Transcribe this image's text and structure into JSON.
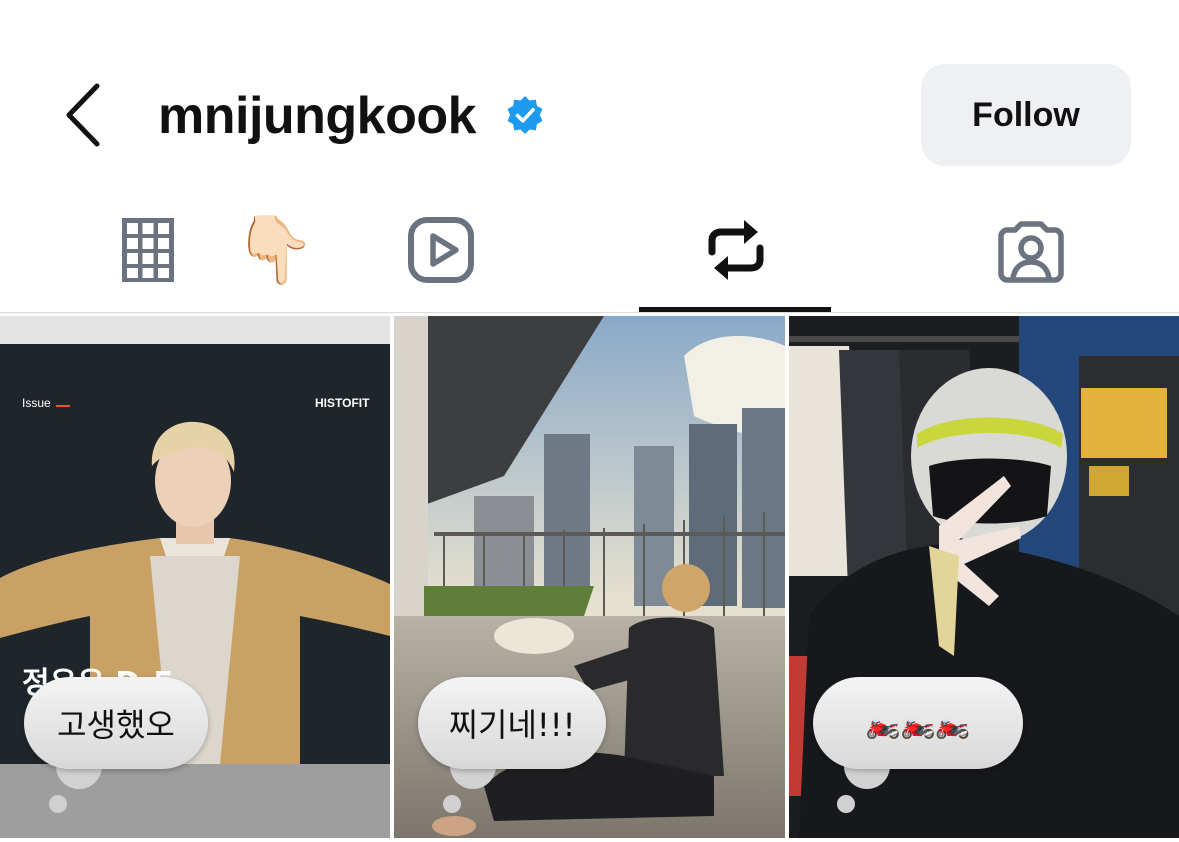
{
  "header": {
    "username": "mnijungkook",
    "follow_label": "Follow",
    "verified_color": "#1d9bf0"
  },
  "tabs": [
    {
      "name": "grid",
      "icon": "grid-icon"
    },
    {
      "name": "pointing-emoji",
      "icon": "pointing-down-emoji-icon",
      "glyph": "👇🏻"
    },
    {
      "name": "reels",
      "icon": "reels-play-icon"
    },
    {
      "name": "reposts",
      "icon": "repost-icon",
      "active": true
    },
    {
      "name": "tagged",
      "icon": "tagged-person-icon"
    }
  ],
  "tiles": [
    {
      "magazine_issue": "Issue",
      "magazine_brand": "HISTOFIT",
      "magazine_headline": "정우우 D-5",
      "note": "고생했오"
    },
    {
      "note": "찌기네!!!"
    },
    {
      "note": "🏍️🏍️🏍️"
    }
  ],
  "colors": {
    "accent": "#111111",
    "follow_bg": "#eef0f3",
    "icon_gray": "#6b7280"
  }
}
